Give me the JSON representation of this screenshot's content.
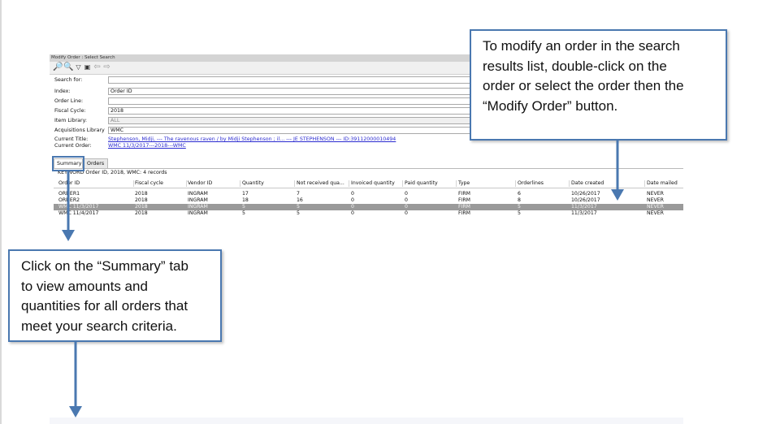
{
  "app": {
    "window_title": "Modify Order : Select Search",
    "toolbar_icons": [
      "binoculars-icon",
      "search-icon",
      "filter-icon",
      "copy-icon",
      "back-arrow-icon",
      "forward-arrow-icon"
    ],
    "form": {
      "search_for_label": "Search for:",
      "search_for_value": "",
      "index_label": "Index:",
      "index_value": "Order ID",
      "order_line_label": "Order Line:",
      "order_line_value": "",
      "fiscal_cycle_label": "Fiscal Cycle:",
      "fiscal_cycle_value": "2018",
      "item_library_label": "Item Library:",
      "item_library_value": "ALL",
      "acq_library_label": "Acquisitions Library",
      "acq_library_value": "WMC",
      "current_title_label": "Current Title:",
      "current_title_value": "Stephenson, Midji, --- The ravenous raven / by Midji Stephenson ; il... --- JE STEPHENSON --- ID:39112000010494",
      "current_order_label": "Current Order:",
      "current_order_value": "WMC 11/3/2017---2018---WMC"
    },
    "tabs": [
      {
        "label": "Summary",
        "active": true
      },
      {
        "label": "Orders",
        "active": false
      }
    ],
    "records_line": "KEYWORD Order ID, 2018, WMC: 4 records",
    "table": {
      "headers": [
        "Order ID",
        "Fiscal cycle",
        "Vendor ID",
        "Quantity",
        "Not received qua...",
        "Invoiced quantity",
        "Paid quantity",
        "Type",
        "Orderlines",
        "Date created",
        "Date mailed"
      ],
      "rows": [
        [
          "ORDER1",
          "2018",
          "INGRAM",
          "17",
          "7",
          "0",
          "0",
          "FIRM",
          "6",
          "10/26/2017",
          "NEVER"
        ],
        [
          "ORDER2",
          "2018",
          "INGRAM",
          "18",
          "16",
          "0",
          "0",
          "FIRM",
          "8",
          "10/26/2017",
          "NEVER"
        ],
        [
          "WMC 11/3/2017",
          "2018",
          "INGRAM",
          "5",
          "5",
          "0",
          "0",
          "FIRM",
          "5",
          "11/3/2017",
          "NEVER"
        ],
        [
          "WMC 11/4/2017",
          "2018",
          "INGRAM",
          "5",
          "5",
          "0",
          "0",
          "FIRM",
          "5",
          "11/3/2017",
          "NEVER"
        ]
      ],
      "selected_row": 2
    }
  },
  "callouts": {
    "top_right": [
      "To modify an order in the search",
      "results list, double-click on the",
      "order or select the order then the",
      "“Modify Order” button."
    ],
    "bottom_left": [
      "Click on the “Summary” tab",
      "to view amounts and",
      "quantities for all orders that",
      "meet your search criteria."
    ]
  },
  "colors": {
    "callout_border": "#4a78b0",
    "arrow": "#4a78b0",
    "selected_row": "#9a9a9a",
    "link": "#2a2ad0"
  }
}
